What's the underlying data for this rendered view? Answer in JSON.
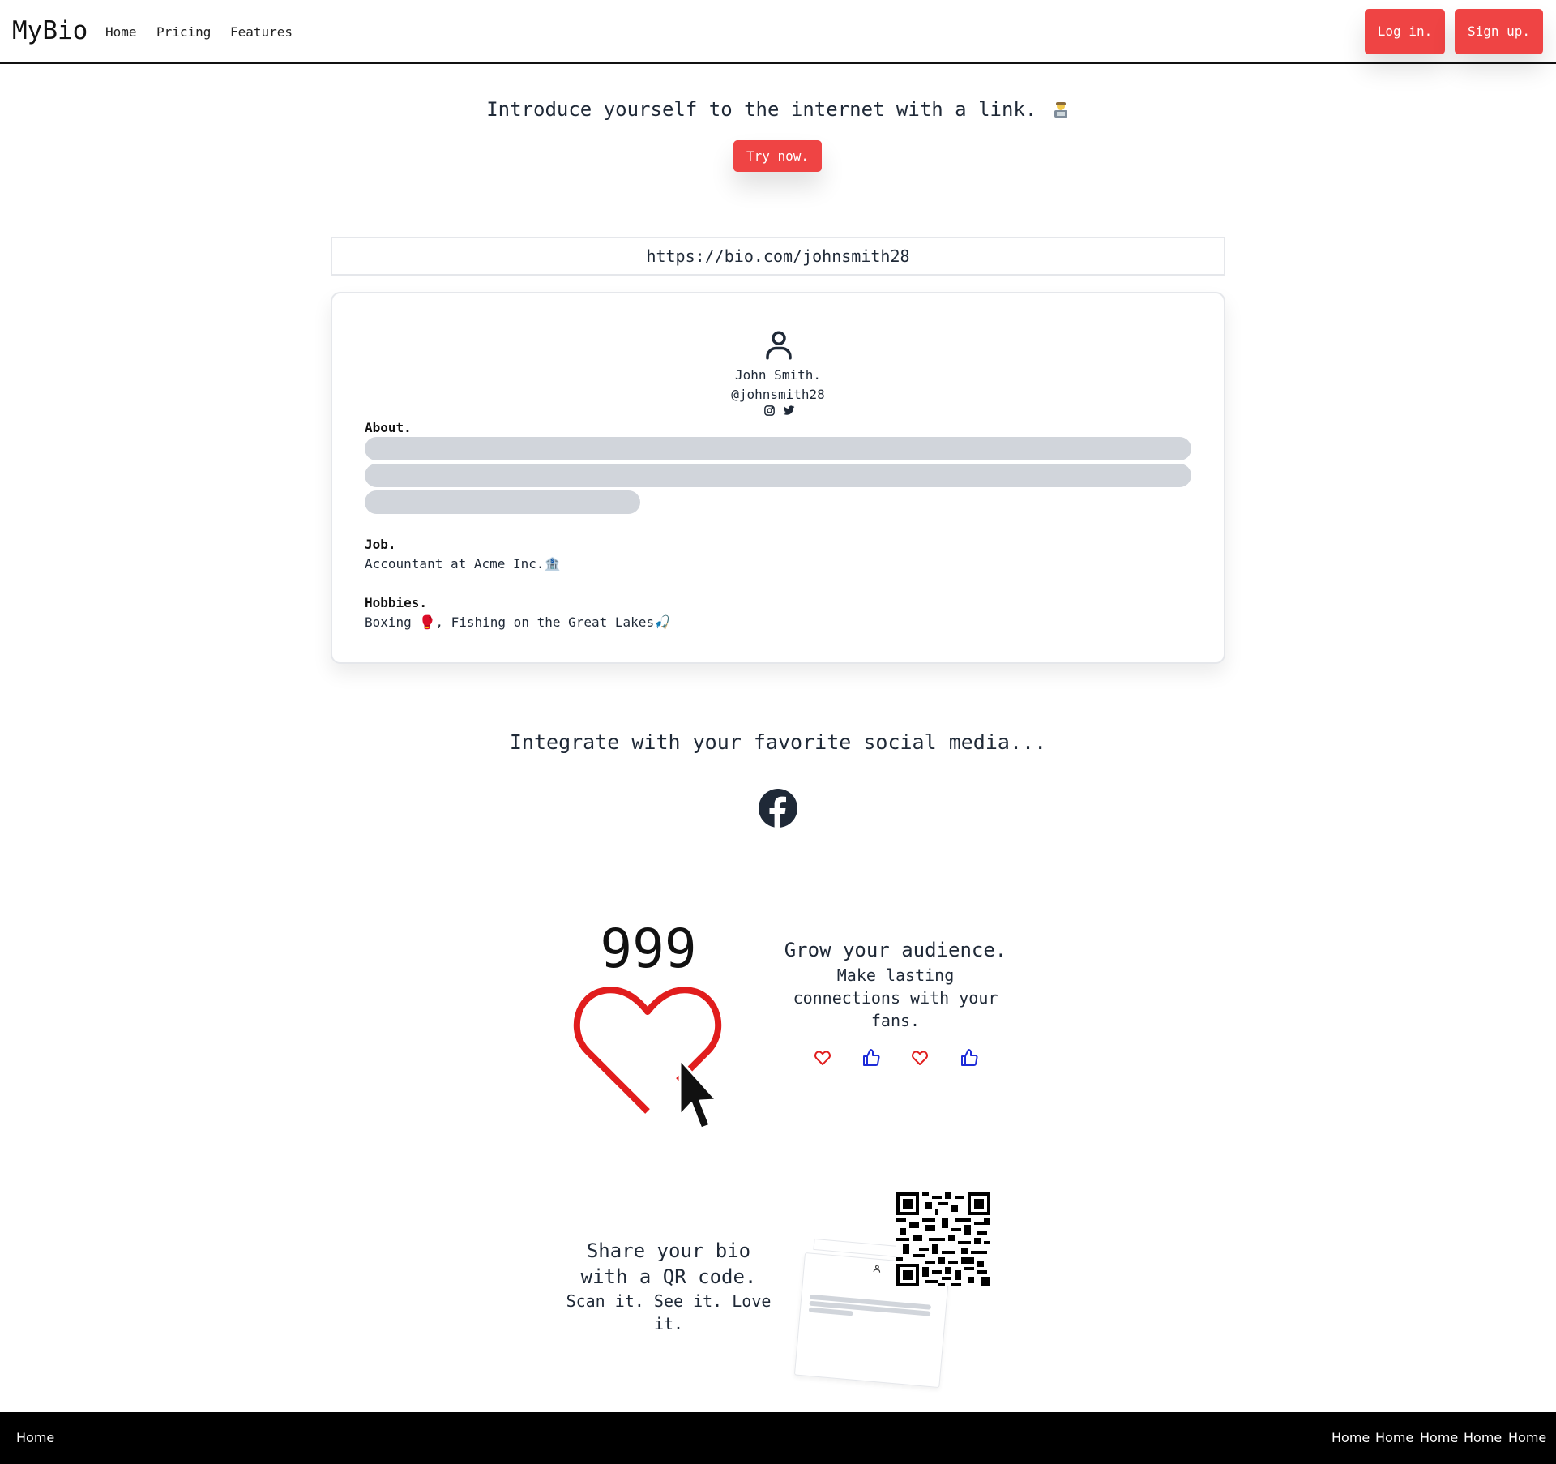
{
  "nav": {
    "brand": "MyBio",
    "links": [
      "Home",
      "Pricing",
      "Features"
    ],
    "login": "Log in.",
    "signup": "Sign up."
  },
  "hero": {
    "title": "Introduce yourself to the internet with a link.",
    "cta": "Try now."
  },
  "profile": {
    "url": "https://bio.com/johnsmith28",
    "name": "John Smith.",
    "handle": "@johnsmith28",
    "about_label": "About.",
    "job_label": "Job.",
    "job_value": "Accountant at Acme Inc.🏦",
    "hobbies_label": "Hobbies.",
    "hobbies_value": "Boxing 🥊, Fishing on the Great Lakes🎣",
    "social_icons": [
      "instagram-icon",
      "twitter-icon"
    ]
  },
  "social": {
    "title": "Integrate with your favorite social media...",
    "icon": "facebook-icon"
  },
  "grow": {
    "counter": "999",
    "title": "Grow your audience.",
    "subtitle_lines": [
      "Make lasting",
      "connections with your",
      "fans."
    ],
    "reaction_icons": [
      "heart-icon",
      "thumbs-up-icon",
      "heart-icon",
      "thumbs-up-icon"
    ]
  },
  "share": {
    "title_lines": [
      "Share your bio",
      "with a QR code."
    ],
    "subtitle_lines": [
      "Scan it. See it. Love",
      "it."
    ]
  },
  "footer": {
    "left_link": "Home",
    "right_links": [
      "Home",
      "Home",
      "Home",
      "Home",
      "Home"
    ]
  },
  "colors": {
    "accent": "#ef4444",
    "heart": "#e11d1d",
    "thumb": "#1d2bd8",
    "skeleton": "#d1d5db"
  }
}
